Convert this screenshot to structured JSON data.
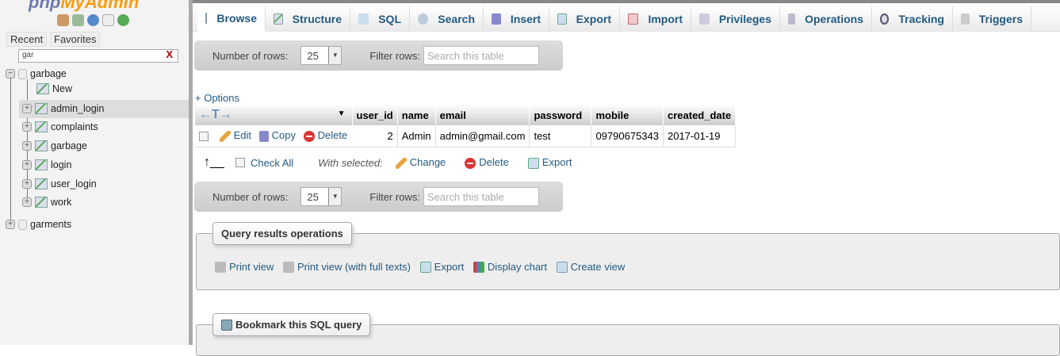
{
  "logo": {
    "text_php": "php",
    "text_my": "MyAdmin"
  },
  "sidebar": {
    "nav_icons": [
      "home-icon",
      "logout-icon",
      "help-icon",
      "docs-icon",
      "reload-icon"
    ],
    "recent_label": "Recent",
    "favorites_label": "Favorites",
    "filter_value": "gar",
    "clear_label": "X",
    "databases": [
      {
        "name": "garbage",
        "expanded": true,
        "new_label": "New",
        "tables": [
          "admin_login",
          "complaints",
          "garbage",
          "login",
          "user_login",
          "work"
        ]
      },
      {
        "name": "garments",
        "expanded": false
      }
    ],
    "selected_table": "admin_login"
  },
  "tabs": [
    {
      "label": "Browse",
      "active": true
    },
    {
      "label": "Structure"
    },
    {
      "label": "SQL"
    },
    {
      "label": "Search"
    },
    {
      "label": "Insert"
    },
    {
      "label": "Export"
    },
    {
      "label": "Import"
    },
    {
      "label": "Privileges"
    },
    {
      "label": "Operations"
    },
    {
      "label": "Tracking"
    },
    {
      "label": "Triggers"
    }
  ],
  "navbar": {
    "rows_label": "Number of rows:",
    "rows_value": "25",
    "filter_label": "Filter rows:",
    "filter_placeholder": "Search this table"
  },
  "options_label": "+ Options",
  "table": {
    "columns": [
      "user_id",
      "name",
      "email",
      "password",
      "mobile",
      "created_date"
    ],
    "rows": [
      {
        "cells": [
          "2",
          "Admin",
          "admin@gmail.com",
          "test",
          "09790675343",
          "2017-01-19"
        ],
        "edit": "Edit",
        "copy": "Copy",
        "delete": "Delete"
      }
    ]
  },
  "bulk": {
    "check_all": "Check All",
    "with_selected": "With selected:",
    "change": "Change",
    "delete": "Delete",
    "export": "Export"
  },
  "query_ops": {
    "title": "Query results operations",
    "items": [
      "Print view",
      "Print view (with full texts)",
      "Export",
      "Display chart",
      "Create view"
    ]
  },
  "bookmark": {
    "title": "Bookmark this SQL query"
  }
}
